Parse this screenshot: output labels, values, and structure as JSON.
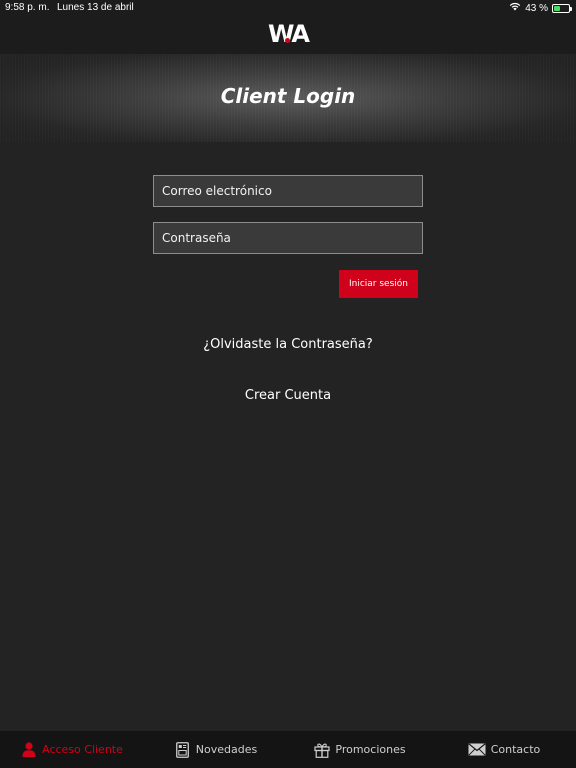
{
  "status_bar": {
    "time": "9:58 p. m.",
    "date": "Lunes 13 de abril",
    "battery": "43 %",
    "battery_level": 0.43
  },
  "nav": {
    "logo_text": "WA"
  },
  "banner": {
    "title": "Client Login"
  },
  "form": {
    "email_placeholder": "Correo electrónico",
    "email_value": "",
    "password_placeholder": "Contraseña",
    "password_value": "",
    "login_label": "Iniciar sesión"
  },
  "links": {
    "forgot_label": "¿Olvidaste la Contraseña?",
    "create_label": "Crear Cuenta"
  },
  "tabs": [
    {
      "label": "Acceso Cliente",
      "icon": "person-icon",
      "active": true
    },
    {
      "label": "Novedades",
      "icon": "news-icon",
      "active": false
    },
    {
      "label": "Promociones",
      "icon": "gift-icon",
      "active": false
    },
    {
      "label": "Contacto",
      "icon": "envelope-icon",
      "active": false
    }
  ],
  "colors": {
    "accent": "#d0021b",
    "background": "#232323",
    "field_background": "#3a3a3a",
    "tab_bar": "#141414"
  }
}
